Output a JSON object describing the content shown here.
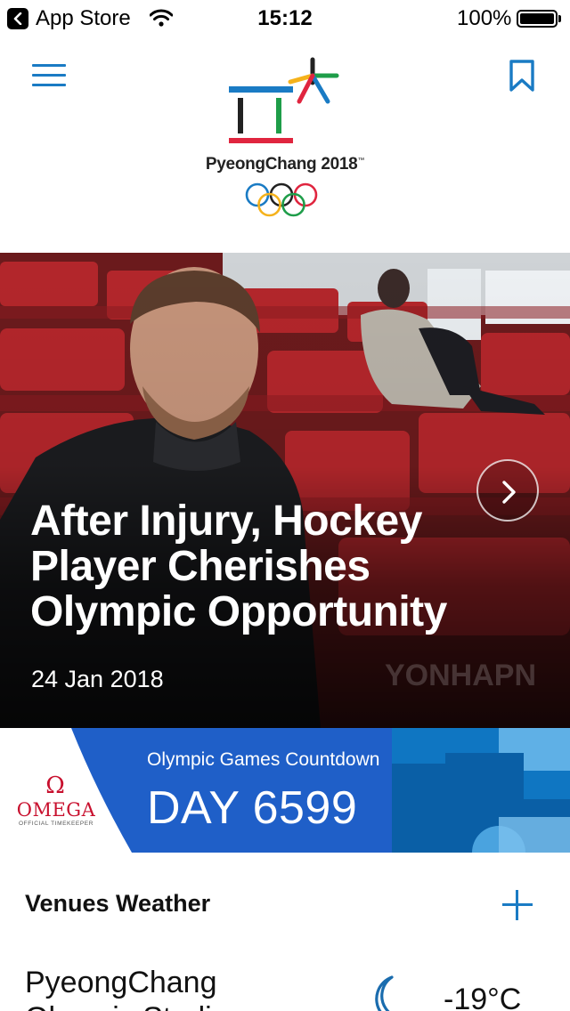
{
  "status_bar": {
    "back_app": "App Store",
    "time": "15:12",
    "battery": "100%"
  },
  "header": {
    "logo_text": "PyeongChang 2018",
    "logo_mark": "™",
    "menu_icon": "hamburger-icon",
    "bookmark_icon": "bookmark-icon",
    "accent_color": "#1a7bc4"
  },
  "hero": {
    "title": "After Injury, Hockey Player Cherishes Olympic Opportunity",
    "date": "24 Jan 2018",
    "watermark": "YONHAPN",
    "next_icon": "chevron-right-icon"
  },
  "countdown": {
    "sponsor": "OMEGA",
    "sponsor_symbol": "Ω",
    "sponsor_subtitle": "OFFICIAL TIMEKEEPER",
    "label": "Olympic Games Countdown",
    "day_text": "DAY 6599",
    "banner_color": "#1f5fc8"
  },
  "weather": {
    "heading": "Venues Weather",
    "add_icon": "plus-icon",
    "venues": [
      {
        "name": "PyeongChang Olympic Stadium",
        "icon": "moon-icon",
        "temperature": "-19°C"
      }
    ]
  }
}
